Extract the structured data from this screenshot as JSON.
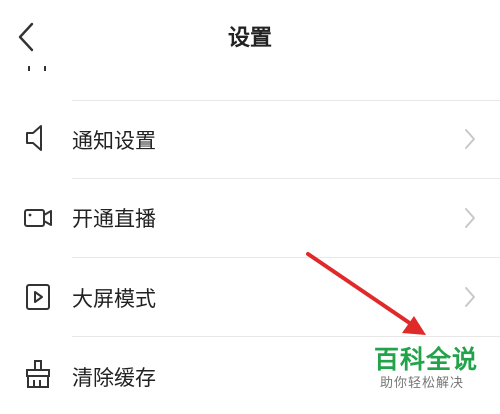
{
  "header": {
    "title": "设置"
  },
  "rows": [
    {
      "label": "通知设置",
      "icon": "speaker-icon"
    },
    {
      "label": "开通直播",
      "icon": "video-camera-icon"
    },
    {
      "label": "大屏模式",
      "icon": "play-square-icon"
    },
    {
      "label": "清除缓存",
      "icon": "broom-icon"
    }
  ],
  "watermark": {
    "main": "百科全说",
    "sub": "助你轻松解决"
  },
  "colors": {
    "arrow": "#e02a2a",
    "watermark_green": "#22a34a",
    "icon": "#333333",
    "chevron": "#c8c8c8"
  }
}
